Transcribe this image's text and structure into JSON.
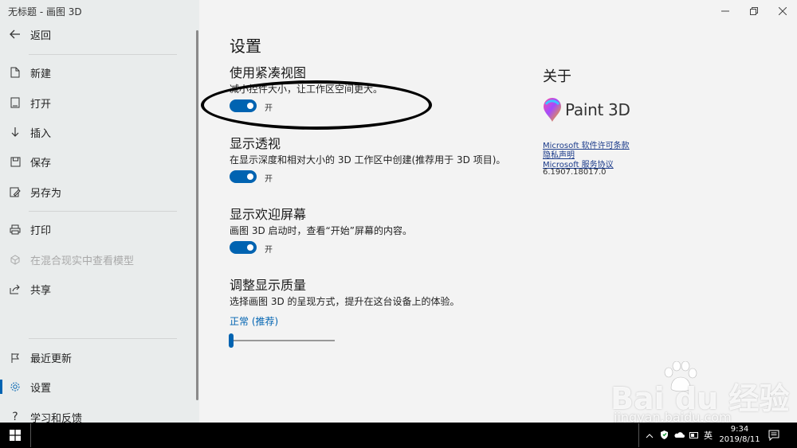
{
  "window": {
    "title": "无标题 - 画图 3D"
  },
  "sidebar": {
    "back": "返回",
    "items": [
      {
        "label": "新建"
      },
      {
        "label": "打开"
      },
      {
        "label": "插入"
      },
      {
        "label": "保存"
      },
      {
        "label": "另存为"
      },
      {
        "label": "打印"
      },
      {
        "label": "在混合现实中查看模型"
      },
      {
        "label": "共享"
      },
      {
        "label": "最近更新"
      },
      {
        "label": "设置"
      },
      {
        "label": "学习和反馈"
      }
    ]
  },
  "settings": {
    "title": "设置",
    "compact": {
      "title": "使用紧凑视图",
      "desc": "减小控件大小，让工作区空间更大。",
      "state": "开"
    },
    "perspective": {
      "title": "显示透视",
      "desc": "在显示深度和相对大小的 3D 工作区中创建(推荐用于 3D 项目)。",
      "state": "开"
    },
    "welcome": {
      "title": "显示欢迎屏幕",
      "desc": "画图 3D 启动时，查看“开始”屏幕的内容。",
      "state": "开"
    },
    "quality": {
      "title": "调整显示质量",
      "desc": "选择画图 3D 的呈现方式，提升在这台设备上的体验。",
      "value": "正常 (推荐)",
      "slider_fraction": 0.0
    }
  },
  "about": {
    "title": "关于",
    "logo_text": "Paint 3D",
    "license": "Microsoft 软件许可条款",
    "privacy": "隐私声明",
    "services": "Microsoft 服务协议",
    "version": "6.1907.18017.0"
  },
  "watermark": {
    "main": "Bai du 经验",
    "sub": "jingyan.baidu.com"
  },
  "taskbar": {
    "ime": "英",
    "time": "9:34",
    "date": "2019/8/11"
  },
  "colors": {
    "accent": "#0063b1",
    "sidebar": "#e9ecec",
    "main": "#f3f3f3"
  }
}
